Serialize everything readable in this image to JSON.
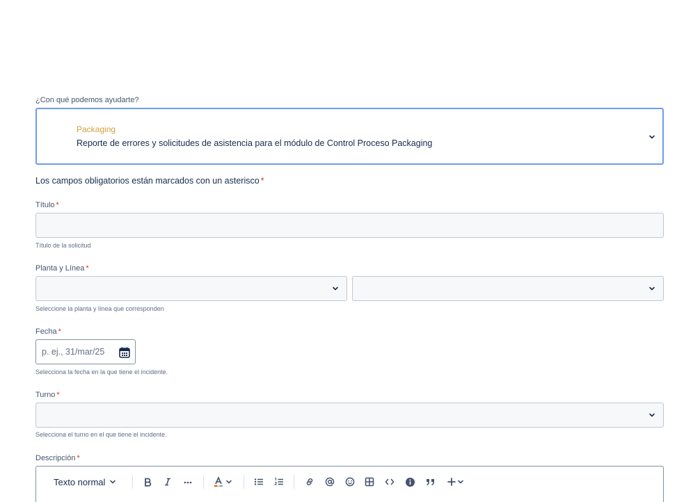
{
  "help_question": "¿Con qué podemos ayudarte?",
  "request_type": {
    "name": "Packaging",
    "description": "Reporte de errores y solicitudes de asistencia para el módulo de Control Proceso Packaging"
  },
  "required_note": "Los campos obligatorios están marcados con un asterisco",
  "required_marker": "*",
  "fields": {
    "titulo": {
      "label": "Título",
      "value": "",
      "helper": "Título de la solicitud"
    },
    "planta_linea": {
      "label": "Planta y Línea",
      "planta_value": "",
      "linea_value": "",
      "helper": "Seleccione la planta y línea que corresponden"
    },
    "fecha": {
      "label": "Fecha",
      "placeholder": "p. ej., 31/mar/25",
      "helper": "Selecciona la fecha en la que tiene el incidente."
    },
    "turno": {
      "label": "Turno",
      "value": "",
      "helper": "Selecciona el turno en el que tiene el incidente."
    },
    "descripcion": {
      "label": "Descripción",
      "text_style": "Texto normal"
    }
  },
  "toolbar_icons": [
    "bold-icon",
    "italic-icon",
    "more-formatting-icon",
    "text-color-icon",
    "bullet-list-icon",
    "numbered-list-icon",
    "link-icon",
    "mention-icon",
    "emoji-icon",
    "table-icon",
    "code-icon",
    "info-icon",
    "quote-icon",
    "insert-icon"
  ],
  "colors": {
    "accent_border": "#6c9cf2",
    "request_type_name": "#d4a03b",
    "required": "#de350b",
    "input_bg": "#f7f8f9"
  }
}
